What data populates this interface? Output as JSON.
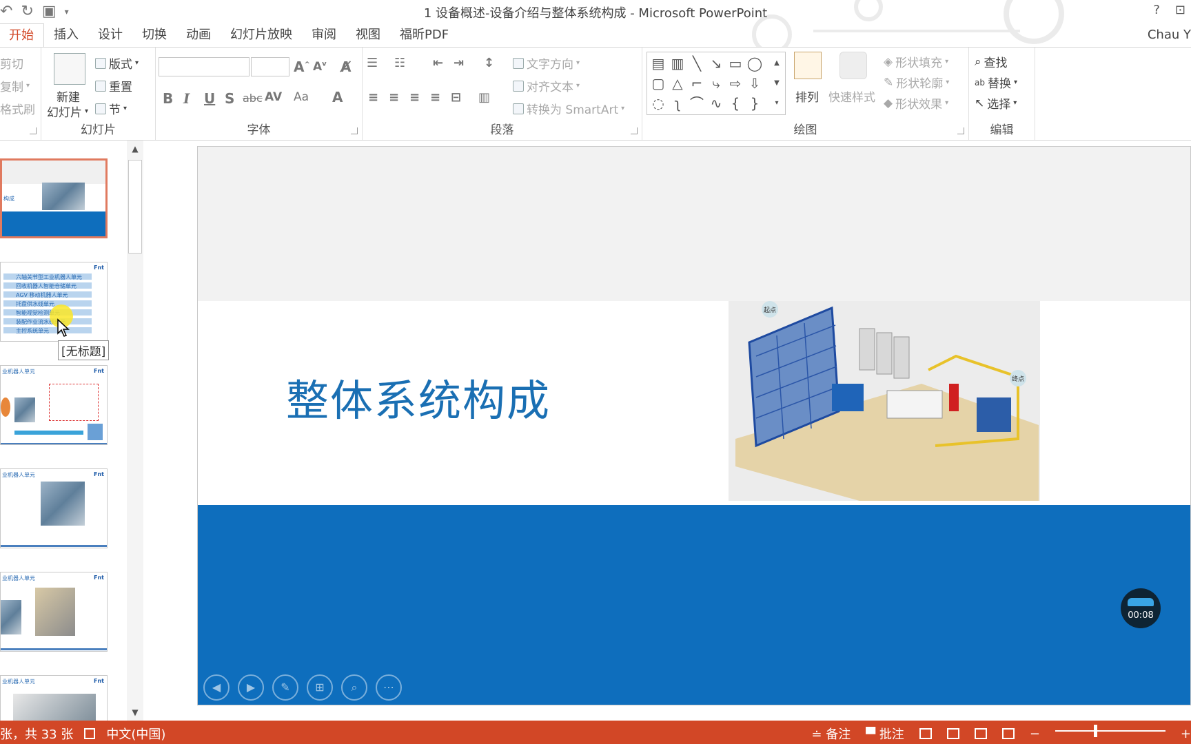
{
  "window": {
    "title": "1 设备概述-设备介绍与整体系统构成 - Microsoft PowerPoint",
    "account": "Chau Y",
    "help": "?"
  },
  "tabs": [
    {
      "label": "开始",
      "active": true
    },
    {
      "label": "插入"
    },
    {
      "label": "设计"
    },
    {
      "label": "切换"
    },
    {
      "label": "动画"
    },
    {
      "label": "幻灯片放映"
    },
    {
      "label": "审阅"
    },
    {
      "label": "视图"
    },
    {
      "label": "福昕PDF"
    }
  ],
  "ribbon": {
    "clipboard": {
      "cut": "剪切",
      "copy": "复制",
      "format_painter": "格式刷"
    },
    "slides": {
      "new_slide_line1": "新建",
      "new_slide_line2": "幻灯片",
      "layout": "版式",
      "reset": "重置",
      "section": "节",
      "label": "幻灯片"
    },
    "font": {
      "label": "字体",
      "font_name": "",
      "font_size": ""
    },
    "paragraph": {
      "label": "段落",
      "text_direction": "文字方向",
      "align_text": "对齐文本",
      "convert_smartart": "转换为 SmartArt"
    },
    "drawing": {
      "label": "绘图",
      "arrange": "排列",
      "quick_styles": "快速样式",
      "shape_fill": "形状填充",
      "shape_outline": "形状轮廓",
      "shape_effects": "形状效果"
    },
    "editing": {
      "label": "编辑",
      "find": "查找",
      "replace": "替换",
      "select": "选择"
    }
  },
  "thumbnails": {
    "slide1_text": "构成",
    "slide2_rows": [
      "六轴关节型工业机器人单元",
      "回收机器人智能仓储单元",
      "AGV 移动机器人单元",
      "托盘供水线单元",
      "智能视觉检测单元",
      "装配作业流水线单元",
      "主控系统单元"
    ],
    "slide3_title": "业机器人单元",
    "slide4_title": "业机器人单元",
    "slide5_title": "业机器人单元",
    "slide6_title": "业机器人单元",
    "tooltip": "[无标题]"
  },
  "slide": {
    "title": "整体系统构成",
    "image_label_start": "起点",
    "image_label_end": "终点",
    "timer": "00:08"
  },
  "status": {
    "slide_info": "张，共 33 张",
    "language": "中文(中国)",
    "notes": "备注",
    "comments": "批注"
  },
  "colors": {
    "accent": "#d24726",
    "slide_blue": "#0e6ebd",
    "title_blue": "#1a6fb3"
  }
}
